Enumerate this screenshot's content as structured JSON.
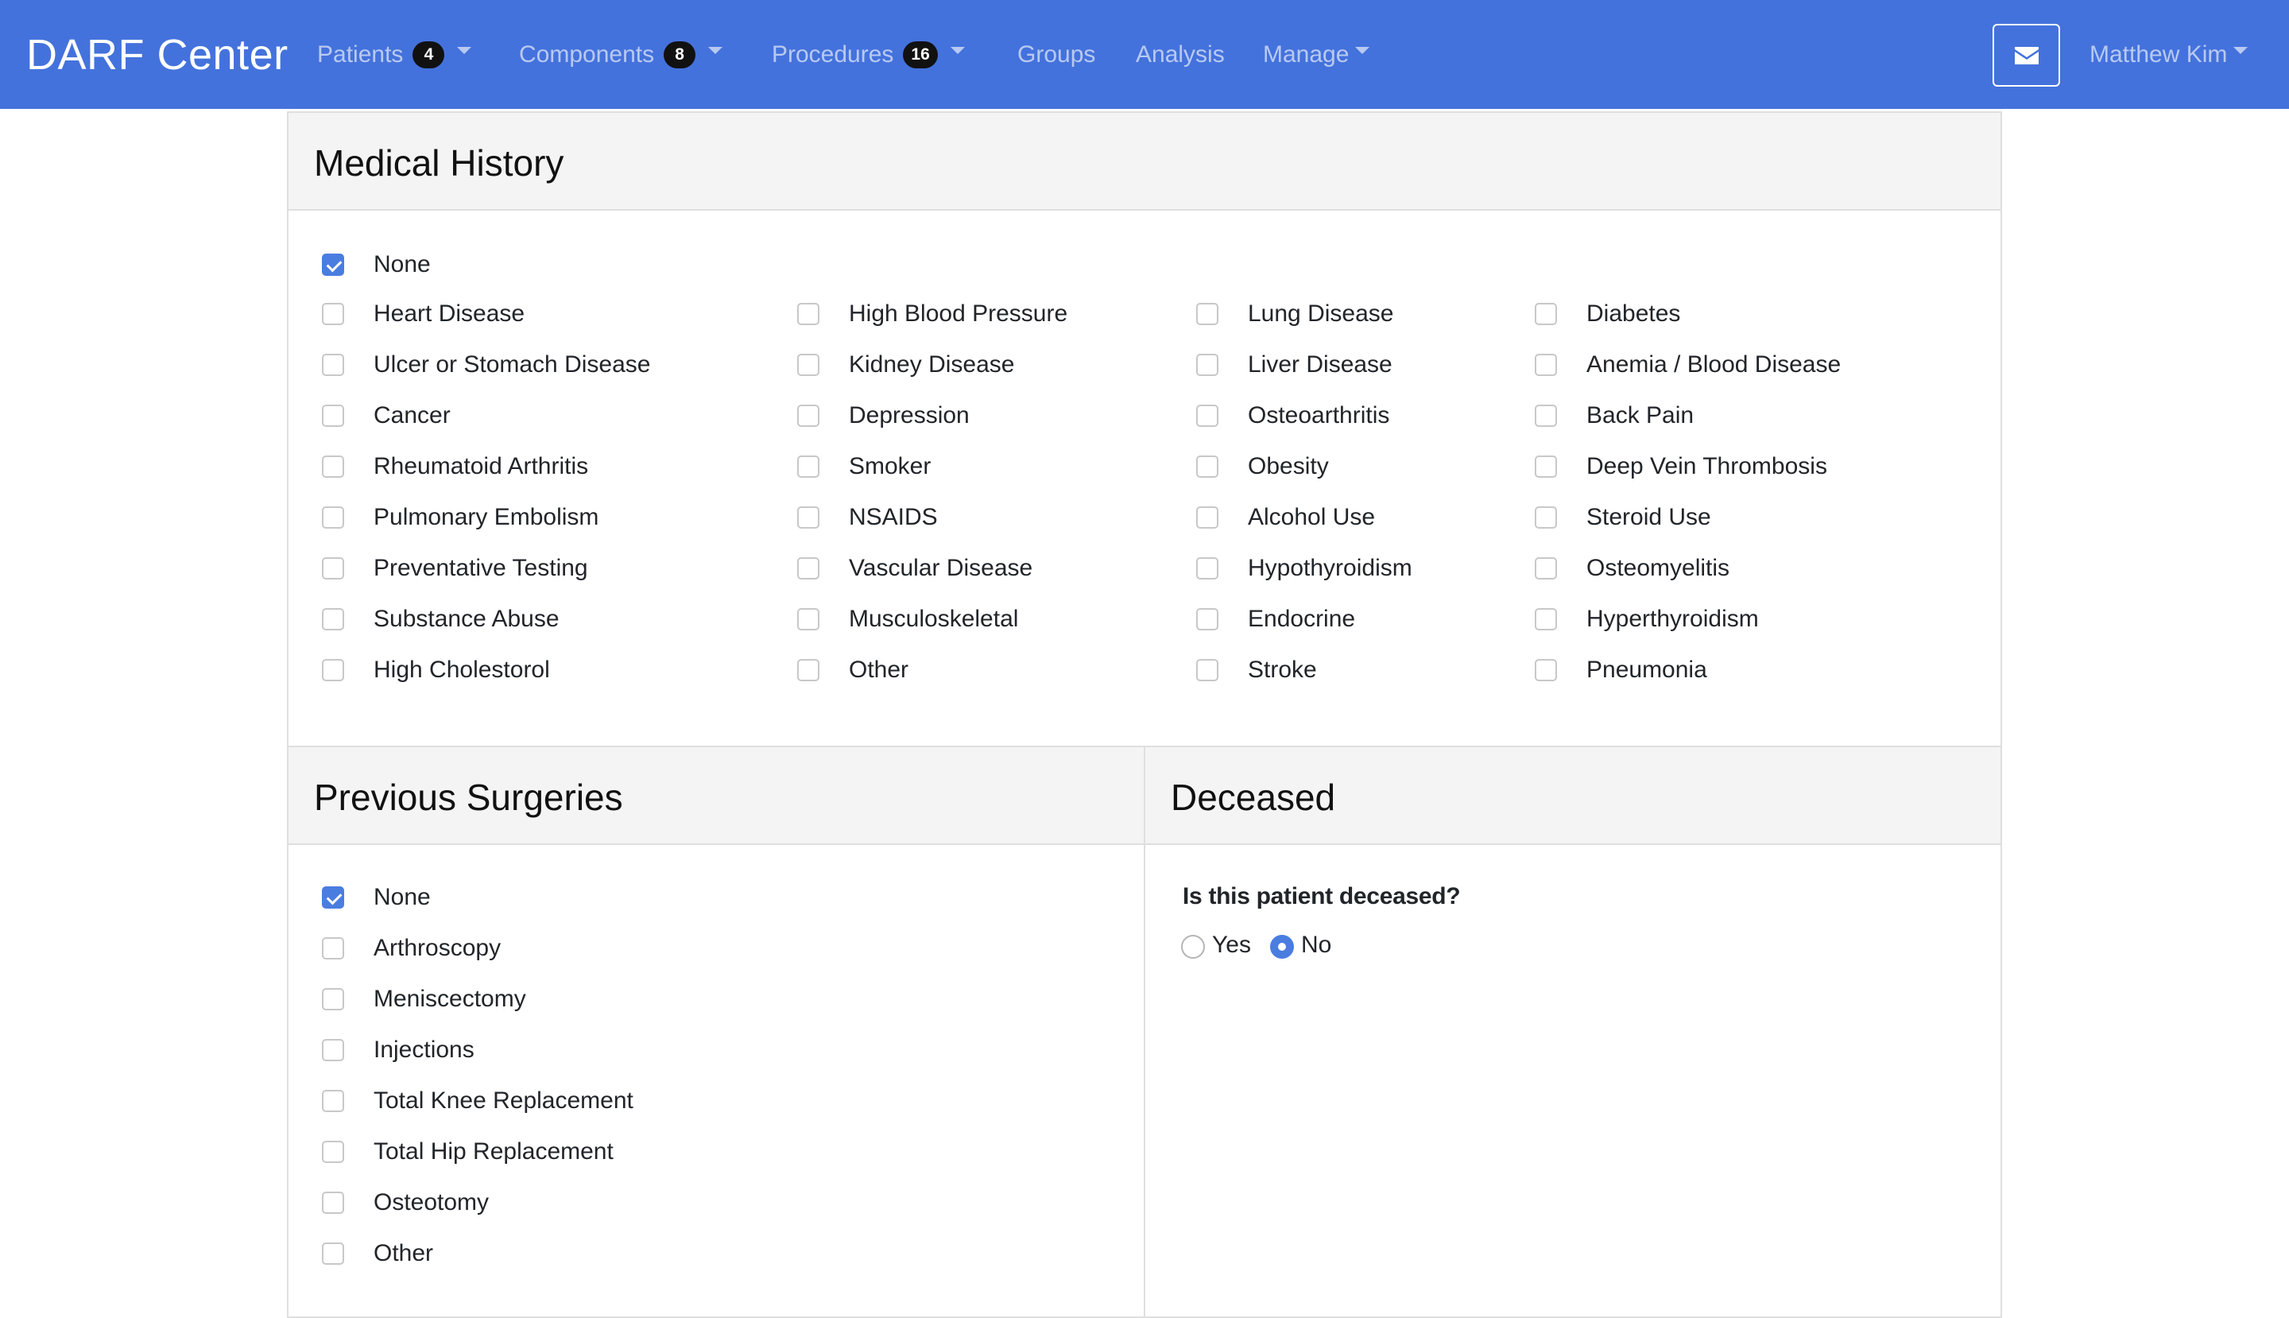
{
  "navbar": {
    "brand": "DARF Center",
    "items": [
      {
        "label": "Patients",
        "badge": "4"
      },
      {
        "label": "Components",
        "badge": "8"
      },
      {
        "label": "Procedures",
        "badge": "16"
      },
      {
        "label": "Groups"
      },
      {
        "label": "Analysis"
      },
      {
        "label": "Manage"
      }
    ],
    "mail_icon": "envelope-icon",
    "user": "Matthew Kim",
    "color": "#4472dc"
  },
  "medical_history": {
    "title": "Medical History",
    "none_label": "None",
    "none_checked": true,
    "conditions": [
      [
        "Heart Disease",
        "High Blood Pressure",
        "Lung Disease",
        "Diabetes"
      ],
      [
        "Ulcer or Stomach Disease",
        "Kidney Disease",
        "Liver Disease",
        "Anemia / Blood Disease"
      ],
      [
        "Cancer",
        "Depression",
        "Osteoarthritis",
        "Back Pain"
      ],
      [
        "Rheumatoid Arthritis",
        "Smoker",
        "Obesity",
        "Deep Vein Thrombosis"
      ],
      [
        "Pulmonary Embolism",
        "NSAIDS",
        "Alcohol Use",
        "Steroid Use"
      ],
      [
        "Preventative Testing",
        "Vascular Disease",
        "Hypothyroidism",
        "Osteomyelitis"
      ],
      [
        "Substance Abuse",
        "Musculoskeletal",
        "Endocrine",
        "Hyperthyroidism"
      ],
      [
        "High Cholestorol",
        "Other",
        "Stroke",
        "Pneumonia"
      ]
    ]
  },
  "previous_surgeries": {
    "title": "Previous Surgeries",
    "items": [
      {
        "label": "None",
        "checked": true
      },
      {
        "label": "Arthroscopy",
        "checked": false
      },
      {
        "label": "Meniscectomy",
        "checked": false
      },
      {
        "label": "Injections",
        "checked": false
      },
      {
        "label": "Total Knee Replacement",
        "checked": false
      },
      {
        "label": "Total Hip Replacement",
        "checked": false
      },
      {
        "label": "Osteotomy",
        "checked": false
      },
      {
        "label": "Other",
        "checked": false
      }
    ]
  },
  "deceased": {
    "title": "Deceased",
    "question": "Is this patient deceased?",
    "options": [
      {
        "label": "Yes",
        "selected": false
      },
      {
        "label": "No",
        "selected": true
      }
    ]
  },
  "accent_color": "#4a7de0"
}
